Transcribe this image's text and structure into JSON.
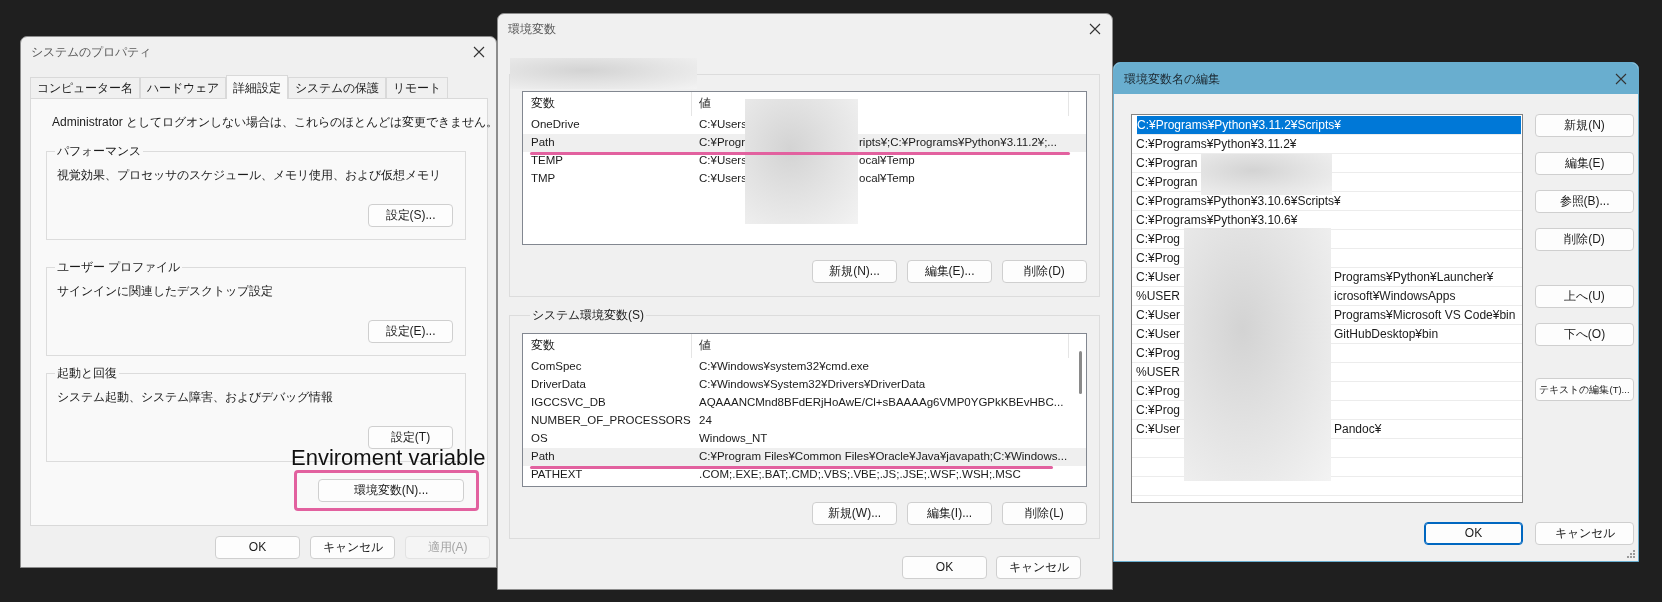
{
  "system_properties": {
    "title": "システムのプロパティ",
    "tabs": [
      {
        "label": "コンピューター名",
        "selected": false
      },
      {
        "label": "ハードウェア",
        "selected": false
      },
      {
        "label": "詳細設定",
        "selected": true
      },
      {
        "label": "システムの保護",
        "selected": false
      },
      {
        "label": "リモート",
        "selected": false
      }
    ],
    "notice": "Administrator としてログオンしない場合は、これらのほとんどは変更できません。",
    "groups": [
      {
        "title": "パフォーマンス",
        "description": "視覚効果、プロセッサのスケジュール、メモリ使用、および仮想メモリ",
        "button": "設定(S)..."
      },
      {
        "title": "ユーザー プロファイル",
        "description": "サインインに関連したデスクトップ設定",
        "button": "設定(E)..."
      },
      {
        "title": "起動と回復",
        "description": "システム起動、システム障害、およびデバッグ情報",
        "button": "設定(T)"
      }
    ],
    "env_button": {
      "label": "環境変数(N)...",
      "marked": true
    },
    "buttons": [
      {
        "label": "OK",
        "disabled": false
      },
      {
        "label": "キャンセル",
        "disabled": false
      },
      {
        "label": "適用(A)",
        "disabled": true
      }
    ]
  },
  "annotation": {
    "label": "Enviroment variable"
  },
  "environment_variables": {
    "title": "環境変数",
    "user_variables": {
      "columns": [
        "変数",
        "値"
      ],
      "rows": [
        {
          "name": "OneDrive",
          "value": "C:¥Users",
          "selected": false,
          "marked": false
        },
        {
          "name": "Path",
          "value": "C:¥Progr",
          "value_tail": "ripts¥;C:¥Programs¥Python¥3.11.2¥;...",
          "selected": true,
          "marked": true
        },
        {
          "name": "TEMP",
          "value": "C:¥Users",
          "value_tail": "ocal¥Temp",
          "selected": false,
          "marked": false
        },
        {
          "name": "TMP",
          "value": "C:¥Users",
          "value_tail": "ocal¥Temp",
          "selected": false,
          "marked": false
        }
      ],
      "buttons": [
        "新規(N)...",
        "編集(E)...",
        "削除(D)"
      ]
    },
    "system_variables": {
      "title": "システム環境変数(S)",
      "columns": [
        "変数",
        "値"
      ],
      "rows": [
        {
          "name": "ComSpec",
          "value": "C:¥Windows¥system32¥cmd.exe",
          "selected": false,
          "marked": false
        },
        {
          "name": "DriverData",
          "value": "C:¥Windows¥System32¥Drivers¥DriverData",
          "selected": false,
          "marked": false
        },
        {
          "name": "IGCCSVC_DB",
          "value": "AQAAANCMnd8BFdERjHoAwE/Cl+sBAAAAg6VMP0YGPkKBEvHBC...",
          "selected": false,
          "marked": false
        },
        {
          "name": "NUMBER_OF_PROCESSORS",
          "value": "24",
          "selected": false,
          "marked": false
        },
        {
          "name": "OS",
          "value": "Windows_NT",
          "selected": false,
          "marked": false
        },
        {
          "name": "Path",
          "value": "C:¥Program Files¥Common Files¥Oracle¥Java¥javapath;C:¥Windows...",
          "selected": true,
          "marked": true
        },
        {
          "name": "PATHEXT",
          "value": ".COM;.EXE;.BAT;.CMD;.VBS;.VBE;.JS;.JSE;.WSF;.WSH;.MSC",
          "selected": false,
          "marked": false
        }
      ],
      "buttons": [
        "新規(W)...",
        "編集(I)...",
        "削除(L)"
      ]
    },
    "buttons": [
      "OK",
      "キャンセル"
    ]
  },
  "edit_variable": {
    "title": "環境変数名の編集",
    "entries": [
      {
        "text": "C:¥Programs¥Python¥3.11.2¥Scripts¥",
        "selected": true
      },
      {
        "text": "C:¥Programs¥Python¥3.11.2¥",
        "selected": false
      },
      {
        "text": "C:¥Progran",
        "selected": false
      },
      {
        "text": "C:¥Progran",
        "selected": false
      },
      {
        "text": "C:¥Programs¥Python¥3.10.6¥Scripts¥",
        "selected": false
      },
      {
        "text": "C:¥Programs¥Python¥3.10.6¥",
        "selected": false
      },
      {
        "text": "C:¥Prog",
        "selected": false
      },
      {
        "text": "C:¥Prog",
        "selected": false
      },
      {
        "text": "C:¥User",
        "tail": "Programs¥Python¥Launcher¥",
        "selected": false
      },
      {
        "text": "%USER",
        "tail": "icrosoft¥WindowsApps",
        "selected": false
      },
      {
        "text": "C:¥User",
        "tail": "Programs¥Microsoft VS Code¥bin",
        "selected": false
      },
      {
        "text": "C:¥User",
        "tail": "GitHubDesktop¥bin",
        "selected": false
      },
      {
        "text": "C:¥Prog",
        "selected": false
      },
      {
        "text": "%USER",
        "selected": false
      },
      {
        "text": "C:¥Prog",
        "selected": false
      },
      {
        "text": "C:¥Prog",
        "selected": false
      },
      {
        "text": "C:¥User",
        "tail": "Pandoc¥",
        "selected": false
      }
    ],
    "button_groups": [
      [
        "新規(N)",
        "編集(E)",
        "参照(B)...",
        "削除(D)"
      ],
      [
        "上へ(U)",
        "下へ(O)"
      ],
      [
        "テキストの編集(T)..."
      ]
    ],
    "buttons": [
      {
        "label": "OK",
        "default": true
      },
      {
        "label": "キャンセル",
        "default": false
      }
    ]
  }
}
